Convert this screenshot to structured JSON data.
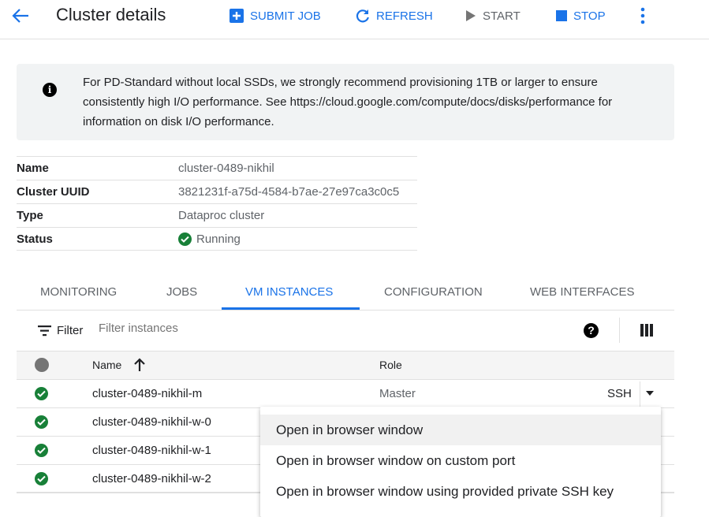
{
  "header": {
    "title": "Cluster details",
    "submit_job": "SUBMIT JOB",
    "refresh": "REFRESH",
    "start": "START",
    "stop": "STOP"
  },
  "banner": {
    "text": "For PD-Standard without local SSDs, we strongly recommend provisioning 1TB or larger to ensure consistently high I/O performance. See https://cloud.google.com/compute/docs/disks/performance for information on disk I/O performance."
  },
  "details": [
    {
      "label": "Name",
      "value": "cluster-0489-nikhil"
    },
    {
      "label": "Cluster UUID",
      "value": "3821231f-a75d-4584-b7ae-27e97ca3c0c5"
    },
    {
      "label": "Type",
      "value": "Dataproc cluster"
    },
    {
      "label": "Status",
      "value": "Running"
    }
  ],
  "tabs": [
    "MONITORING",
    "JOBS",
    "VM INSTANCES",
    "CONFIGURATION",
    "WEB INTERFACES"
  ],
  "filter": {
    "label": "Filter",
    "placeholder": "Filter instances"
  },
  "table": {
    "columns": [
      "Name",
      "Role"
    ],
    "rows": [
      {
        "name": "cluster-0489-nikhil-m",
        "role": "Master",
        "ssh": "SSH"
      },
      {
        "name": "cluster-0489-nikhil-w-0"
      },
      {
        "name": "cluster-0489-nikhil-w-1"
      },
      {
        "name": "cluster-0489-nikhil-w-2"
      }
    ]
  },
  "ssh_menu": [
    "Open in browser window",
    "Open in browser window on custom port",
    "Open in browser window using provided private SSH key"
  ],
  "colors": {
    "accent": "#1a73e8",
    "success": "#188038"
  }
}
